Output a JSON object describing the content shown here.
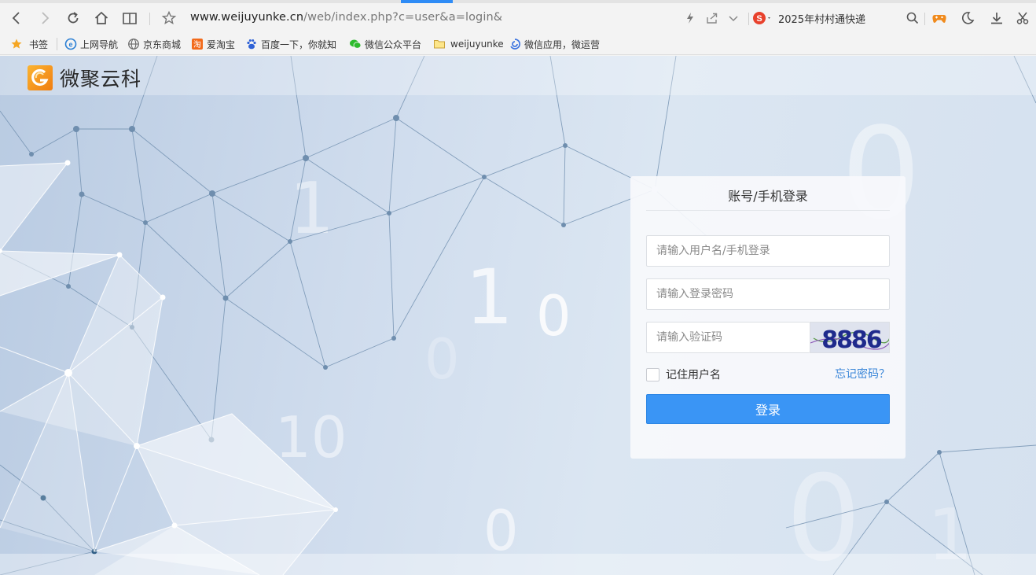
{
  "browser": {
    "url_host": "www.weijuyunke.cn",
    "url_path": "/web/index.php?c=user&a=login&",
    "search_text": "2025年村村通快递",
    "icons": {
      "back": "back-icon",
      "forward": "forward-icon",
      "reload": "reload-icon",
      "home": "home-icon",
      "reader": "reader-icon",
      "favorite": "star-icon",
      "lightning": "lightning-icon",
      "share": "share-icon",
      "dropdown": "chevron-down-icon",
      "search_engine": "sogou-icon",
      "search": "search-icon",
      "game": "gamepad-icon",
      "night": "moon-icon",
      "download": "download-icon",
      "screenshot": "scissors-icon"
    },
    "accent_color": "#2f8cf6"
  },
  "bookmarks": [
    {
      "label": "书签",
      "icon": "star-icon"
    },
    {
      "label": "上网导航",
      "icon": "ie-icon"
    },
    {
      "label": "京东商城",
      "icon": "globe-icon"
    },
    {
      "label": "爱淘宝",
      "icon": "taobao-icon"
    },
    {
      "label": "百度一下，你就知",
      "icon": "baidu-paw-icon"
    },
    {
      "label": "微信公众平台",
      "icon": "wechat-icon"
    },
    {
      "label": "weijuyunke",
      "icon": "folder-icon"
    },
    {
      "label": "微信应用，微运营",
      "icon": "swirl-icon"
    }
  ],
  "site": {
    "brand_name": "微聚云科"
  },
  "login": {
    "title": "账号/手机登录",
    "username_placeholder": "请输入用户名/手机登录",
    "password_placeholder": "请输入登录密码",
    "captcha_placeholder": "请输入验证码",
    "captcha_text": "8886",
    "remember_label": "记住用户名",
    "forgot_label": "忘记密码？",
    "submit_label": "登录",
    "button_color": "#3a95f5",
    "link_color": "#3a86d8"
  },
  "background_digits": [
    "1",
    "1",
    "0",
    "0",
    "0",
    "10",
    "0",
    "0",
    "1"
  ]
}
